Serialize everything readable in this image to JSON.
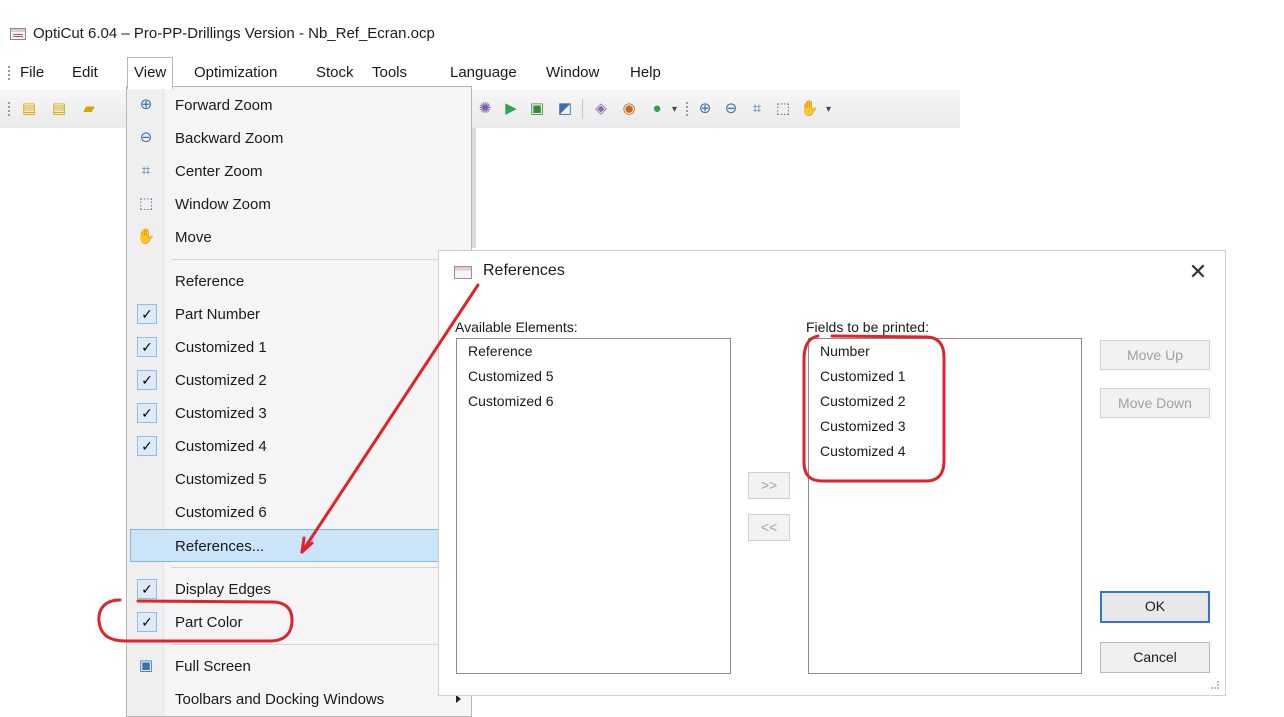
{
  "window": {
    "title": "OptiCut 6.04 – Pro-PP-Drillings Version - Nb_Ref_Ecran.ocp"
  },
  "menubar": {
    "items": [
      "File",
      "Edit",
      "View",
      "Optimization",
      "Stock",
      "Tools",
      "Language",
      "Window",
      "Help"
    ]
  },
  "view_menu": {
    "zoom_items": [
      {
        "label": "Forward Zoom",
        "icon": "zoom-in-icon"
      },
      {
        "label": "Backward Zoom",
        "icon": "zoom-out-icon"
      },
      {
        "label": "Center Zoom",
        "icon": "zoom-fit-icon"
      },
      {
        "label": "Window Zoom",
        "icon": "zoom-window-icon"
      },
      {
        "label": "Move",
        "icon": "hand-icon"
      }
    ],
    "reference_items": [
      {
        "label": "Reference",
        "checked": false
      },
      {
        "label": "Part Number",
        "checked": true
      },
      {
        "label": "Customized 1",
        "checked": true
      },
      {
        "label": "Customized 2",
        "checked": true
      },
      {
        "label": "Customized 3",
        "checked": true
      },
      {
        "label": "Customized 4",
        "checked": true
      },
      {
        "label": "Customized 5",
        "checked": false
      },
      {
        "label": "Customized 6",
        "checked": false
      }
    ],
    "references_item": "References...",
    "display_items": [
      {
        "label": "Display Edges",
        "checked": true
      },
      {
        "label": "Part Color",
        "checked": true
      }
    ],
    "full_screen": "Full Screen",
    "toolbars": "Toolbars and Docking Windows"
  },
  "dialog": {
    "title": "References",
    "available_label": "Available Elements:",
    "available_items": [
      "Reference",
      "Customized 5",
      "Customized 6"
    ],
    "fields_label": "Fields to be printed:",
    "fields_items": [
      "Number",
      "Customized 1",
      "Customized 2",
      "Customized 3",
      "Customized 4"
    ],
    "buttons": {
      "add": ">>",
      "remove": "<<",
      "move_up": "Move Up",
      "move_down": "Move Down",
      "ok": "OK",
      "cancel": "Cancel"
    }
  },
  "colors": {
    "annotation_red": "#e0222a",
    "highlight_blue": "#cce4f7",
    "default_button_border": "#2e78d4"
  }
}
